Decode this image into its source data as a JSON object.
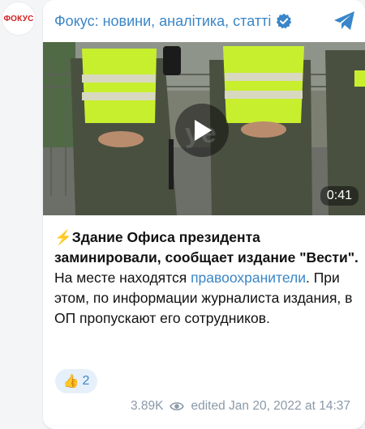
{
  "channel": {
    "avatar_text": "ФОКУС",
    "title": "Фокус: новини, аналітика, статті"
  },
  "video": {
    "duration": "0:41",
    "watermark": "ye"
  },
  "post": {
    "emoji": "⚡",
    "headline": "Здание Офиса президента заминировали, сообщает издание \"Вести\".",
    "body_part1": "На месте находятся ",
    "link_text": "правоохранители",
    "body_part2": ". При этом, по информации журналиста издания, в ОП пропускают его сотрудников."
  },
  "reaction": {
    "emoji": "👍",
    "count": "2"
  },
  "meta": {
    "views": "3.89K",
    "edited_label": "edited",
    "timestamp": "Jan 20, 2022 at 14:37"
  },
  "colors": {
    "accent": "#3a86c8",
    "brand_red": "#d31d1d",
    "vest": "#c8ef2e"
  }
}
